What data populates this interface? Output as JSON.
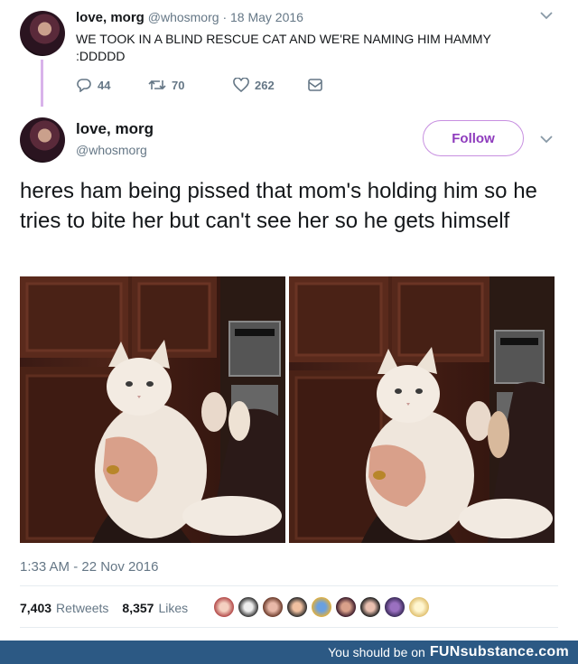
{
  "reply": {
    "name": "love, morg",
    "handle": "@whosmorg",
    "separator": "·",
    "date": "18 May 2016",
    "text": "WE TOOK IN A BLIND RESCUE CAT AND WE'RE NAMING HIM HAMMY :DDDDD",
    "replies": "44",
    "retweets": "70",
    "likes": "262",
    "icons": [
      "reply-icon",
      "retweet-icon",
      "heart-icon",
      "message-icon"
    ]
  },
  "tweet": {
    "name": "love, morg",
    "handle": "@whosmorg",
    "follow_label": "Follow",
    "text": "heres ham being pissed that mom's holding him so he tries to bite her but can't see her so he gets himself",
    "timestamp": "1:33 AM - 22 Nov 2016",
    "retweets_count": "7,403",
    "retweets_label": "Retweets",
    "likes_count": "8,357",
    "likes_label": "Likes"
  },
  "footer": {
    "text": "You should be on",
    "brand": "FUNsubstance.com"
  },
  "colors": {
    "accent": "#8e3bbd",
    "thread_line": "#d9b3ea",
    "footer_bg": "#2c5984",
    "muted": "#657786"
  }
}
